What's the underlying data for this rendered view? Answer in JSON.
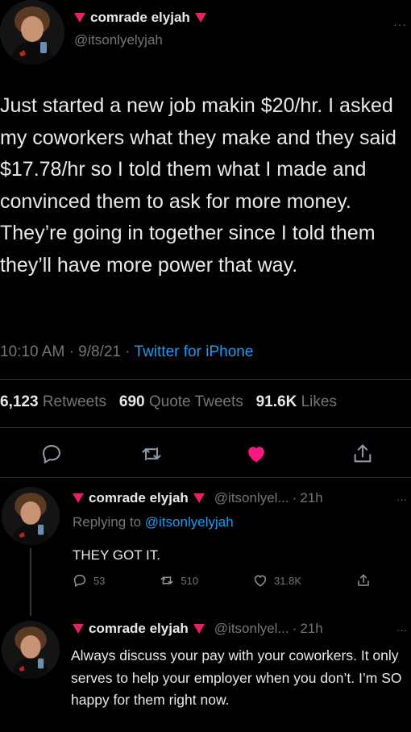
{
  "main_tweet": {
    "display_name": "comrade elyjah",
    "handle": "@itsonlyelyjah",
    "text": "Just started a new job makin $20/hr. I asked my coworkers what they make and they said $17.78/hr so I told them what I made and convinced them to ask for more money. They’re going in together since I told them they’ll have more power that way.",
    "time": "10:10 AM",
    "date": "9/8/21",
    "separator": "·",
    "source": "Twitter for iPhone",
    "more_icon": "more-dots-icon"
  },
  "stats": {
    "retweets_count": "6,123",
    "retweets_label": "Retweets",
    "quotes_count": "690",
    "quotes_label": "Quote Tweets",
    "likes_count": "91.6K",
    "likes_label": "Likes"
  },
  "actions": [
    "reply-icon",
    "retweet-icon",
    "like-icon",
    "share-icon"
  ],
  "colors": {
    "like": "#f91880",
    "link": "#1d9bf0",
    "verified_triangle": "#e0245e",
    "muted": "#71767b"
  },
  "replies": [
    {
      "display_name": "comrade elyjah",
      "handle": "@itsonlyel...",
      "separator": "·",
      "age": "21h",
      "replying_label": "Replying to",
      "replying_handle": "@itsonlyelyjah",
      "text": "THEY GOT IT.",
      "reply_count": "53",
      "retweet_count": "510",
      "like_count": "31.8K"
    },
    {
      "display_name": "comrade elyjah",
      "handle": "@itsonlyel...",
      "separator": "·",
      "age": "21h",
      "text": "Always discuss your pay with your coworkers. It only serves to help your employer when you don’t. I’m SO happy for them right now."
    }
  ]
}
